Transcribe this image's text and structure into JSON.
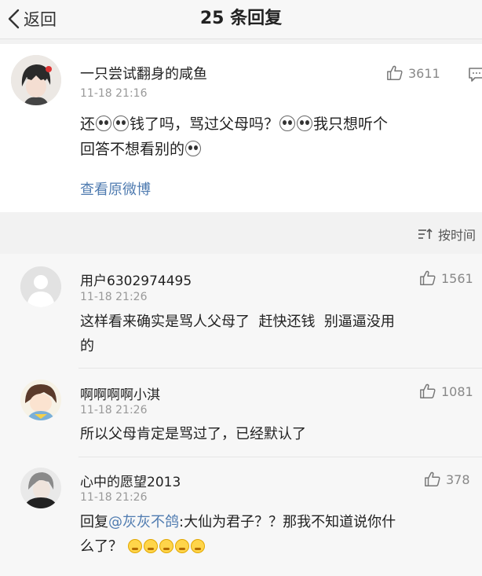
{
  "nav": {
    "back_label": "返回",
    "title": "25 条回复"
  },
  "main_comment": {
    "username": "一只尝试翻身的咸鱼",
    "time": "11-18 21:16",
    "likes": "3611",
    "text_parts": [
      "还",
      "钱了吗，骂过父母吗？",
      "我只想听个",
      "回答不想看别的"
    ],
    "view_origin": "查看原微博"
  },
  "sort": {
    "label": "按时间",
    "icon": "sort-icon"
  },
  "replies": [
    {
      "username": "用户6302974495",
      "time": "11-18 21:26",
      "likes": "1561",
      "line1": "这样看来确实是骂人父母了  赶快还钱  别逼逼没用",
      "line2": "的"
    },
    {
      "username": "啊啊啊啊小淇",
      "time": "11-18 21:26",
      "likes": "1081",
      "line1": "所以父母肯定是骂过了，已经默认了"
    },
    {
      "username": "心中的愿望2013",
      "time": "11-18 21:26",
      "likes": "378",
      "reply_prefix": "回复",
      "mention": "@灰灰不鸽",
      "line1_rest": ":大仙为君子？？那我不知道说你什",
      "line2": "么了？"
    }
  ],
  "colors": {
    "link": "#4f7bb0",
    "card": "#ffffff",
    "bg": "#f2f2f2"
  }
}
